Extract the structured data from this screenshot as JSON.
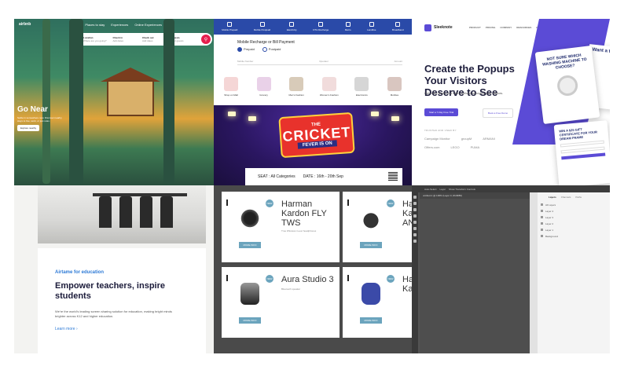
{
  "airbnb": {
    "logo": "airbnb",
    "nav": [
      "Places to stay",
      "Experiences",
      "Online Experiences"
    ],
    "search": [
      {
        "label": "Location",
        "hint": "Where are you going?"
      },
      {
        "label": "Check in",
        "hint": "Add dates"
      },
      {
        "label": "Check out",
        "hint": "Add dates"
      },
      {
        "label": "Guests",
        "hint": "Add guests"
      }
    ],
    "hero_title": "Go Near",
    "hero_sub": "Settle in somewhere new. Discover nearby stays to live, work, or just relax.",
    "hero_button": "Explore nearby"
  },
  "recharge": {
    "services": [
      "Mobile Prepaid",
      "Mobile Postpaid",
      "Electricity",
      "DTH Recharge",
      "Metro",
      "Landline",
      "Broadband"
    ],
    "title": "Mobile Recharge or Bill Payment",
    "radio_prepaid": "Prepaid",
    "radio_postpaid": "Postpaid",
    "fields": [
      "Mobile Number",
      "Operator",
      "Amount"
    ],
    "categories": [
      "Shop on Mall",
      "Grocery",
      "Men's Fashion",
      "Women's Fashion",
      "Electronics",
      "Mobiles"
    ]
  },
  "cricket": {
    "the": "THE",
    "word": "CRICKET",
    "fever": "FEVER IS ON",
    "seat": "SEAT : All Categories",
    "date": "DATE : 16th - 20th Sep"
  },
  "sleeknote": {
    "brand": "Sleeknote",
    "links": [
      "PRODUCT",
      "PRICING",
      "COMPANY",
      "RESOURCES",
      "INSCREENERS"
    ],
    "login": "LOGIN",
    "start": "GET STARTED",
    "headline": "Create the Popups Your Visitors Deserve to See",
    "sub": "Get more leads and sales without annoying your visitors.",
    "btn_trial": "Start a 7-Day Free Trial",
    "btn_demo": "Book a Free Demo",
    "trusted": "TRUSTED AND USED BY",
    "logos": [
      "Campaign Monitor",
      "groupM",
      "ARMANI",
      "Offers.com",
      "LEGO",
      "PUMA"
    ],
    "popup_title": "NOT SURE WHICH WASHING MACHINE TO CHOOSE?",
    "popup2_title": "WIN A $25 GIFT CERTIFICATE FOR YOUR DREAM FRAME",
    "popup3_title": "Want a tip"
  },
  "airtame": {
    "eyebrow": "Airtame for education",
    "headline": "Empower teachers, inspire students",
    "body": "We're the world's leading screen sharing solution for education, making bright minds brighter across K12 and higher education.",
    "link": "Learn more"
  },
  "harman": {
    "badge": "NEW",
    "buy_label": "MORE INFO",
    "products": [
      {
        "name": "Harman\nKardon FLY\nTWS",
        "desc": "True Wireless in-ear headphones"
      },
      {
        "name": "Ha\nKa\nAN",
        "desc": ""
      },
      {
        "name": "Aura Studio 3",
        "desc": "Bluetooth speaker"
      },
      {
        "name": "Ha\nKa",
        "desc": ""
      }
    ]
  },
  "photoshop": {
    "options": [
      "Auto-Select",
      "Layer",
      "Show Transform Controls"
    ],
    "doc_tab": "untitled-1 @ 100% (Layer 0, RGB/8#)",
    "panel_tabs": [
      "Layers",
      "Channels",
      "Paths"
    ],
    "layers": [
      "All Layers",
      "Layer 4",
      "Layer 3",
      "Layer 2",
      "Layer 1",
      "Background"
    ]
  },
  "colors": {
    "airbnb_accent": "#e61e4d",
    "recharge_blue": "#2a4aa8",
    "sleeknote_purple": "#5b4bd6",
    "airtame_blue": "#2d7ad6",
    "harman_teal": "#6ba4bd"
  }
}
